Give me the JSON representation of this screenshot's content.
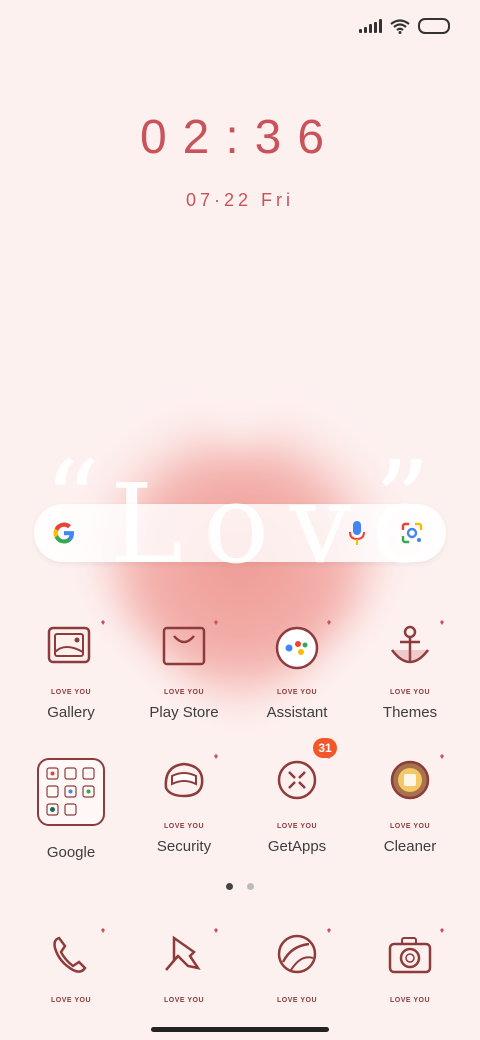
{
  "colors": {
    "accent": "#c9535a",
    "icon_stroke": "#8e3b3b",
    "badge": "#f2562b"
  },
  "clock": {
    "time": "02:36",
    "date": "07·22",
    "day": "Fri"
  },
  "wallpaper": {
    "word": "Love",
    "open_quote": "“",
    "close_quote": "”"
  },
  "search": {
    "icons": [
      "google-g-icon",
      "microphone-icon",
      "google-lens-icon"
    ]
  },
  "apps_row1": [
    {
      "label": "Gallery",
      "icon": "gallery-icon",
      "tag": "LOVE YOU"
    },
    {
      "label": "Play Store",
      "icon": "play-store-icon",
      "tag": "LOVE YOU"
    },
    {
      "label": "Assistant",
      "icon": "assistant-icon",
      "tag": "LOVE YOU"
    },
    {
      "label": "Themes",
      "icon": "themes-icon",
      "tag": "LOVE YOU"
    }
  ],
  "apps_row2": [
    {
      "label": "Google",
      "icon": "google-folder-icon"
    },
    {
      "label": "Security",
      "icon": "security-icon",
      "tag": "LOVE YOU"
    },
    {
      "label": "GetApps",
      "icon": "getapps-icon",
      "tag": "LOVE YOU",
      "badge": "31"
    },
    {
      "label": "Cleaner",
      "icon": "cleaner-icon",
      "tag": "LOVE YOU"
    }
  ],
  "dock": [
    {
      "icon": "phone-icon",
      "tag": "LOVE YOU"
    },
    {
      "icon": "pin-icon",
      "tag": "LOVE YOU"
    },
    {
      "icon": "browser-icon",
      "tag": "LOVE YOU"
    },
    {
      "icon": "camera-icon",
      "tag": "LOVE YOU"
    }
  ],
  "page_indicator": {
    "pages": 2,
    "current": 1
  }
}
